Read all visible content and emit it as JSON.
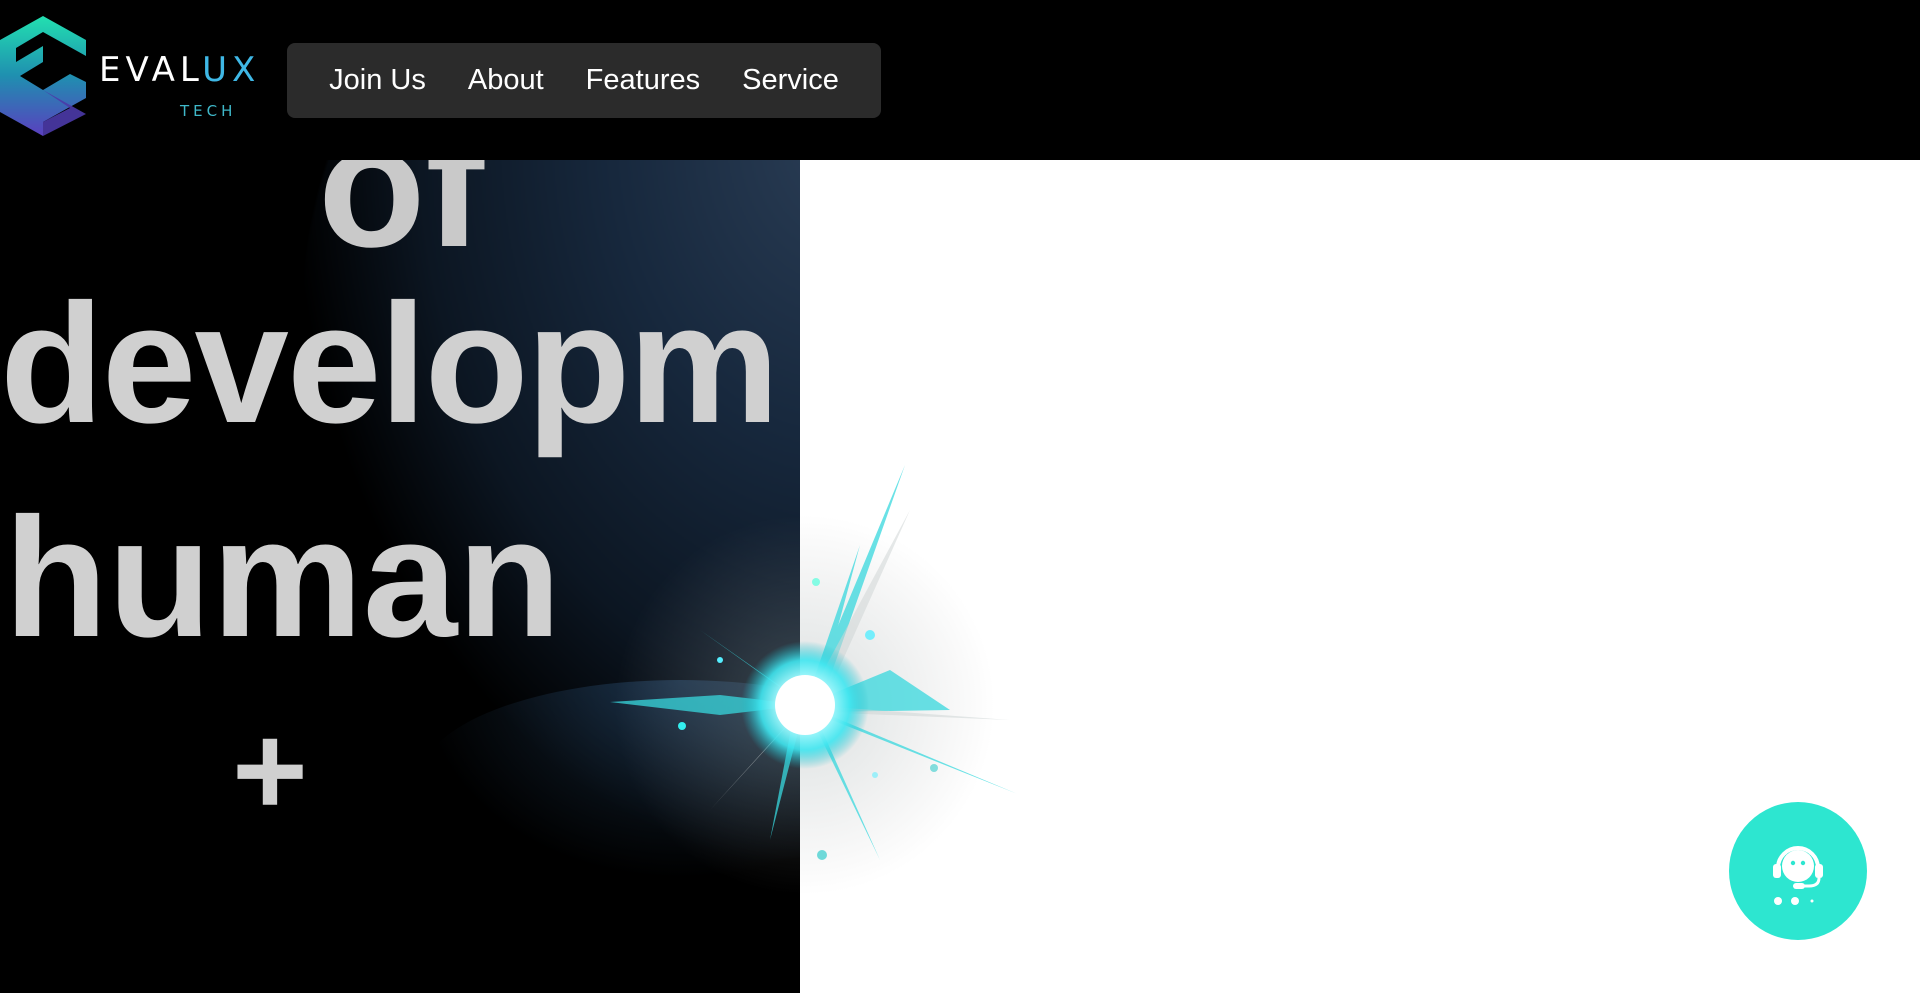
{
  "logo": {
    "word_main": "EVAL",
    "word_accent": "UX",
    "sub": "TECH",
    "colors": {
      "gradient_start": "#22e0b0",
      "gradient_end": "#5a3fbf"
    }
  },
  "nav": {
    "items": [
      {
        "label": "Join Us"
      },
      {
        "label": "About"
      },
      {
        "label": "Features"
      },
      {
        "label": "Service"
      }
    ]
  },
  "hero": {
    "lines": [
      "of",
      "developm",
      "human",
      "+"
    ]
  },
  "support": {
    "icon": "headset-icon",
    "color": "#2de6d0"
  }
}
